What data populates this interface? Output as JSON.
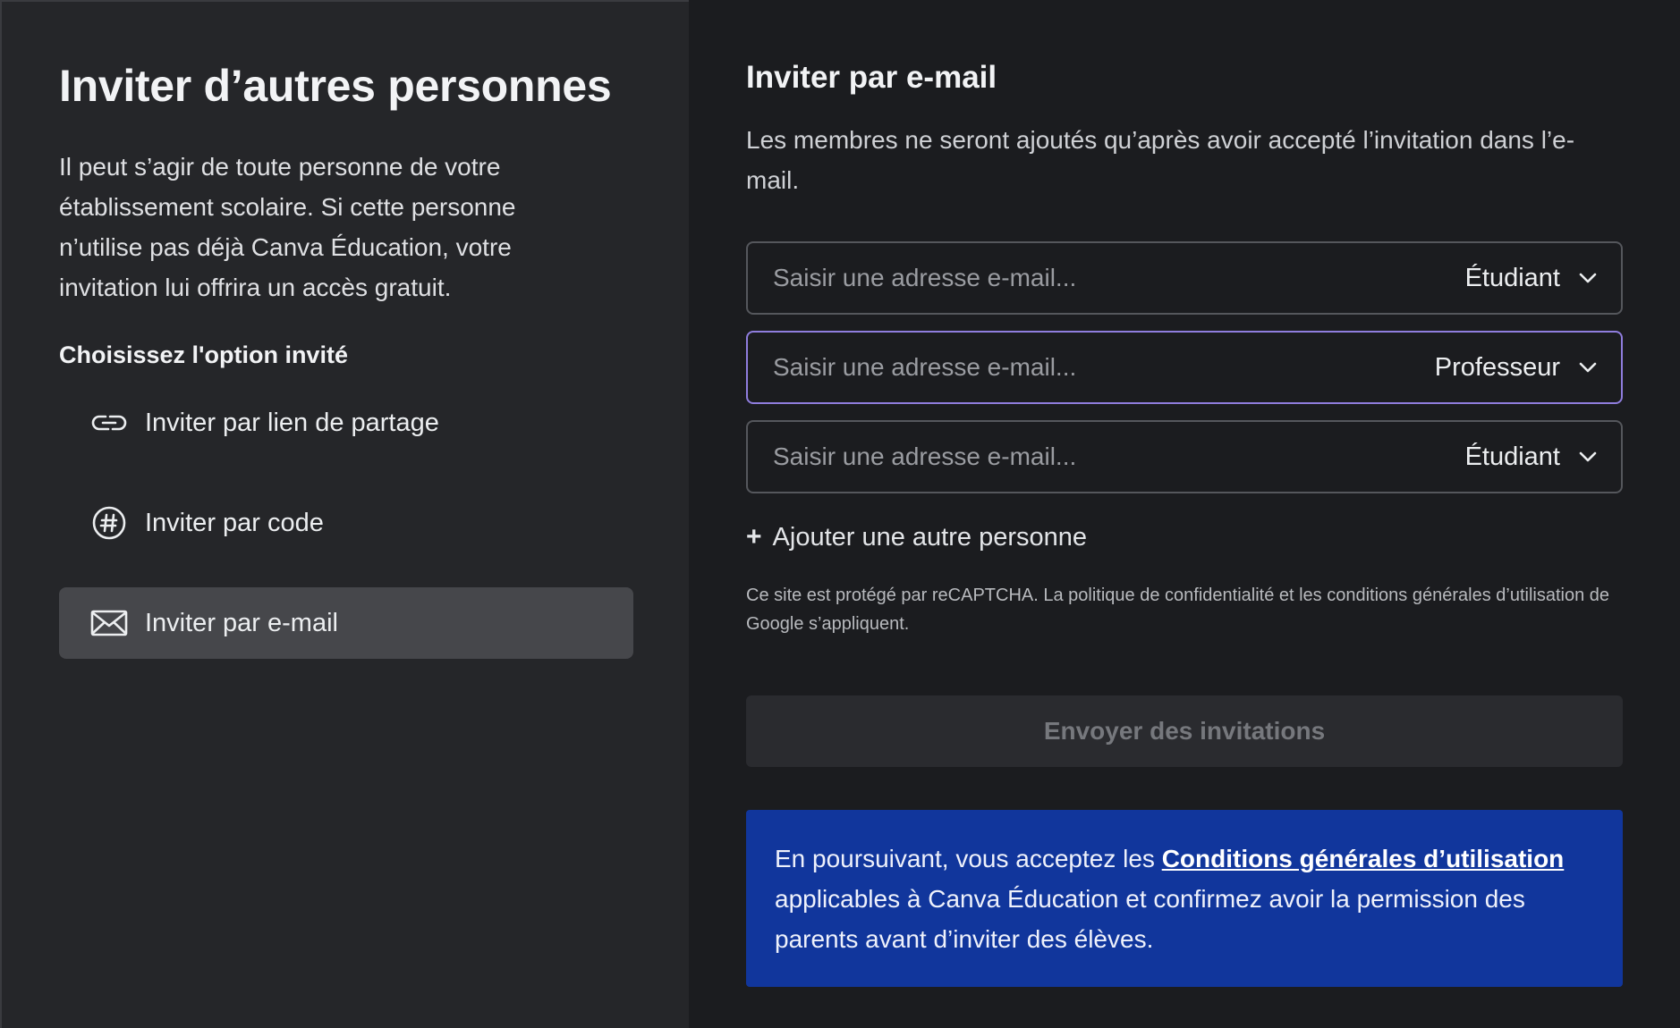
{
  "left": {
    "title": "Inviter d’autres personnes",
    "description": "Il peut s’agir de toute personne de votre établissement scolaire. Si cette personne n’utilise pas déjà Canva Éducation, votre invitation lui offrira un accès gratuit.",
    "subtitle": "Choisissez l'option invité",
    "options": [
      {
        "label": "Inviter par lien de partage",
        "icon": "link-icon",
        "active": false
      },
      {
        "label": "Inviter par code",
        "icon": "hash-icon",
        "active": false
      },
      {
        "label": "Inviter par e-mail",
        "icon": "mail-icon",
        "active": true
      }
    ]
  },
  "right": {
    "title": "Inviter par e-mail",
    "description": "Les membres ne seront ajoutés qu’après avoir accepté l’invitation dans l’e-mail.",
    "rows": [
      {
        "placeholder": "Saisir une adresse e-mail...",
        "value": "",
        "role": "Étudiant",
        "focused": false
      },
      {
        "placeholder": "Saisir une adresse e-mail...",
        "value": "",
        "role": "Professeur",
        "focused": true
      },
      {
        "placeholder": "Saisir une adresse e-mail...",
        "value": "",
        "role": "Étudiant",
        "focused": false
      }
    ],
    "add_person_label": "Ajouter une autre personne",
    "recaptcha_text": "Ce site est protégé par reCAPTCHA. La politique de confidentialité et les conditions générales d’utilisation de Google s’appliquent.",
    "send_button_label": "Envoyer des invitations",
    "terms": {
      "before": "En poursuivant, vous acceptez les ",
      "link": "Conditions générales d’utilisation",
      "after": " applicables à Canva Éducation et confirmez avoir la permission des parents avant d’inviter des élèves."
    }
  },
  "colors": {
    "left_panel_bg": "#252629",
    "right_panel_bg": "#1b1c1f",
    "active_option_bg": "#46474b",
    "focus_border": "#8f7ddd",
    "terms_box_bg": "#11369c",
    "disabled_button_bg": "#2a2b2f"
  }
}
